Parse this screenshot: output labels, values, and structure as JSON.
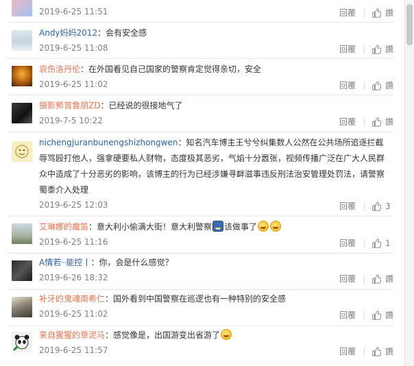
{
  "comments": [
    {
      "user": "",
      "text": "",
      "time": "2019-6-25 11:51",
      "reply": "回覆",
      "like": "讚"
    },
    {
      "user": "Andy妈妈2012",
      "text": "：会有安全感",
      "time": "2019-6-25 11:08",
      "reply": "回覆",
      "like": "讚"
    },
    {
      "user": "哀伤洛丹伦",
      "text": "：在外国看见自己国家的警察肯定觉得亲切，安全",
      "time": "2019-6-25 11:02",
      "reply": "回覆",
      "like": "讚"
    },
    {
      "user": "摄影师曾鲁朋ZD",
      "text": "：已经说的很接地气了",
      "time": "2019-7-5 10:22",
      "reply": "回覆",
      "like": "讚"
    },
    {
      "user": "nichengjuranbunengshizhongwen",
      "text": "：知名汽车博主王兮兮纠集数人公然在公共场所追逐拦截辱骂殴打他人，强拿硬要私人财物，态度极其恶劣，气焰十分嚣张，视频传播广泛在广大人民群众中造成了十分恶劣的影响，该博主的行为已经涉嫌寻衅滋事违反刑法治安管理处罚法，请警察蜀黍介入处理",
      "time": "2019-6-25 12:03",
      "reply": "回覆",
      "like_count": "3"
    },
    {
      "user": "艾琳娜的魔笛",
      "text": "：意大利小偷满大街！意大利警察",
      "text2": "该做事了",
      "time": "2019-6-25 11:16",
      "reply": "回覆",
      "like_count": "1"
    },
    {
      "user": "A情若┈能控丨",
      "text": "：你，会是什么感觉？",
      "time": "2019-6-26 18:32",
      "reply": "回覆",
      "like": "讚"
    },
    {
      "user": "补牙的鬼魂南希仁",
      "text": "：国外看到中国警察在巡逻也有一种特别的安全感",
      "time": "2019-6-25 11:02",
      "reply": "回覆",
      "like": "讚"
    },
    {
      "user": "来自猩猩的草泥马",
      "text": "：感觉像是，出国游变出省游了",
      "time": "2019-6-25 11:57",
      "reply": "回覆",
      "like": "讚"
    }
  ],
  "icons": {
    "like": "thumbs-up-icon",
    "emoji_laugh": "laugh-cry-emoji-icon",
    "emoji_police": "police-emoji-icon"
  },
  "colors": {
    "username_orange": "#eb7350",
    "username_blue": "#2a63a8",
    "meta_gray": "#808080"
  }
}
